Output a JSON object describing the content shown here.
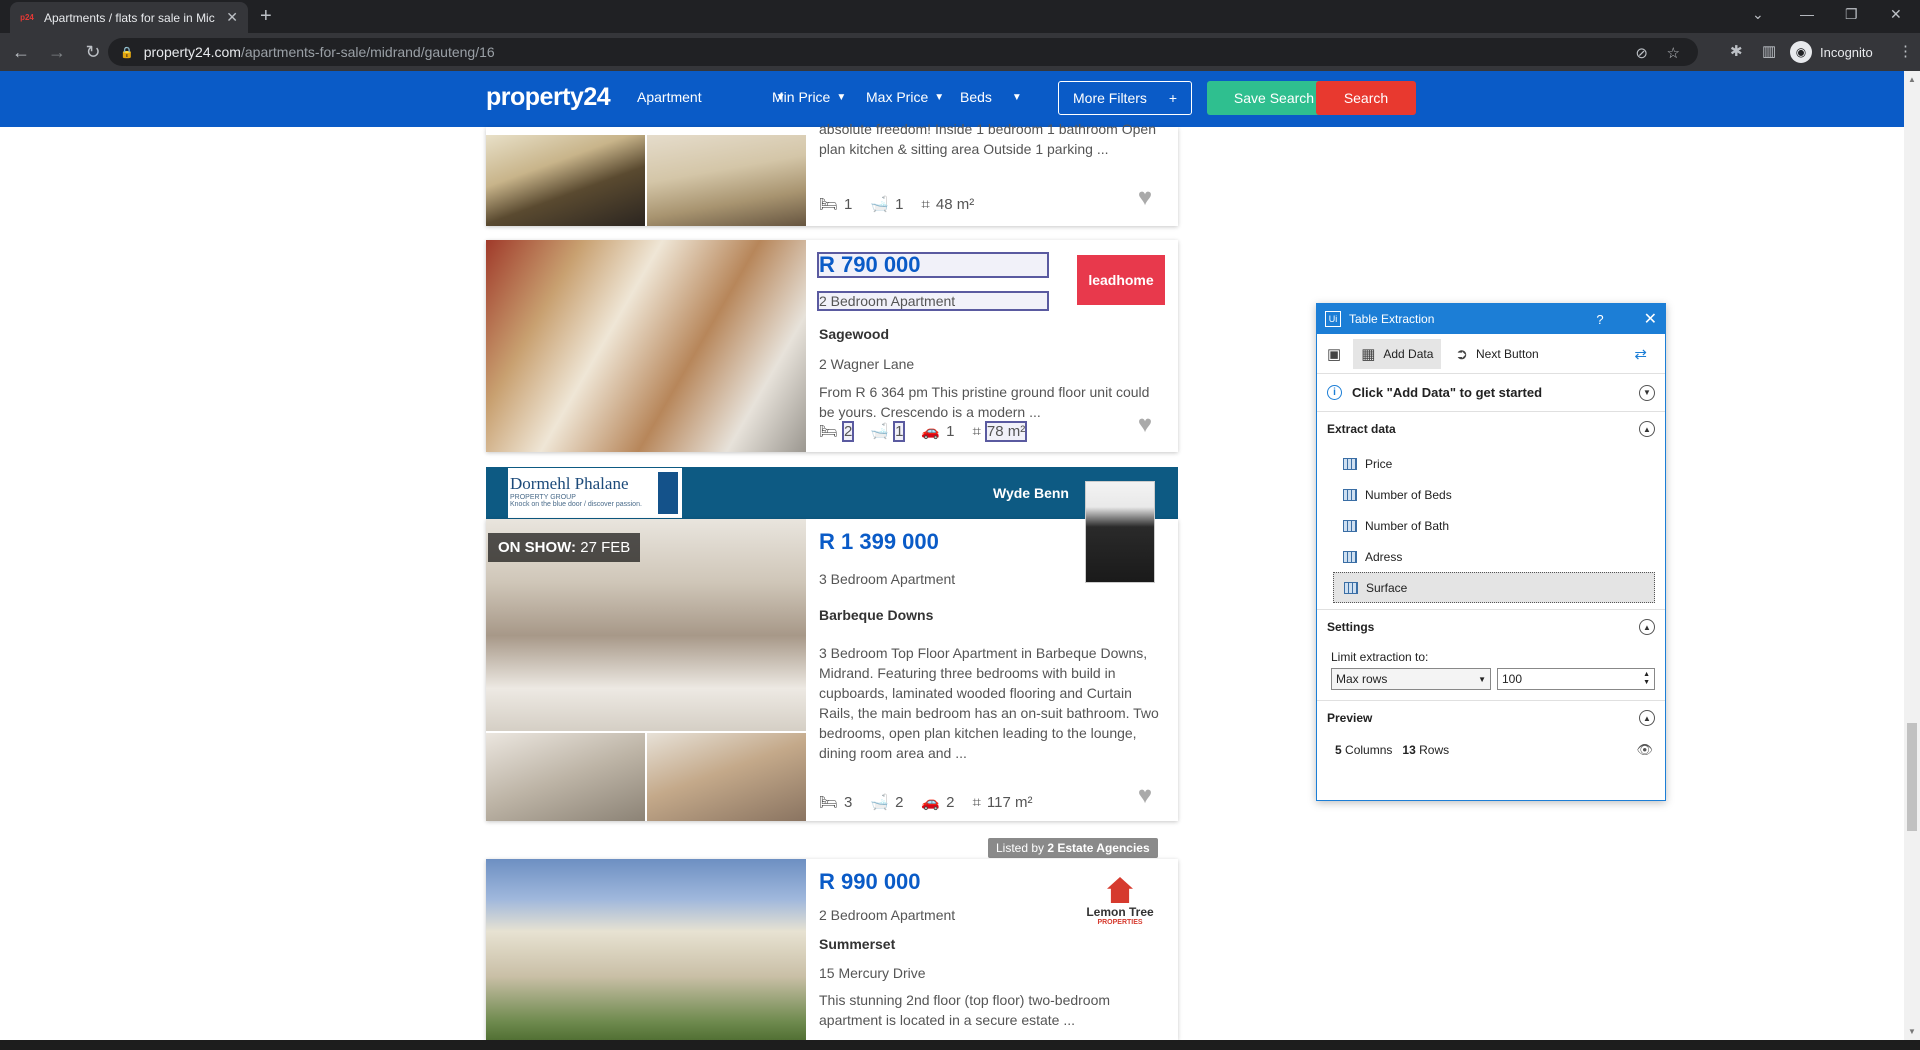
{
  "browser": {
    "tab_title": "Apartments / flats for sale in Mic",
    "tab_favicon": "p24",
    "url_host": "property24.com",
    "url_path": "/apartments-for-sale/midrand/gauteng/16",
    "profile": "Incognito"
  },
  "site": {
    "logo": "property24",
    "type_filter": "Apartment",
    "min_price": "Min Price",
    "max_price": "Max Price",
    "beds": "Beds",
    "more_filters": "More Filters",
    "more_filters_plus": "+",
    "save_search": "Save Search",
    "search": "Search"
  },
  "listings": [
    {
      "description": "absolute freedom! Inside 1 bedroom 1 bathroom Open plan kitchen & sitting area Outside 1 parking ...",
      "beds": "1",
      "baths": "1",
      "size": "48 m²"
    },
    {
      "price": "R 790 000",
      "type": "2 Bedroom Apartment",
      "suburb": "Sagewood",
      "address": "2 Wagner Lane",
      "description": "From R 6 364 pm This pristine ground floor unit could be yours. Crescendo is a modern ...",
      "beds": "2",
      "baths": "1",
      "parking": "1",
      "size": "78 m²",
      "agency_logo": "leadhome"
    },
    {
      "agency": "Dormehl Phalane",
      "agency_sub": "PROPERTY GROUP",
      "agency_tagline": "Knock on the blue door / discover passion.",
      "agent": "Wyde Benn",
      "on_show_label": "ON SHOW:",
      "on_show_date": "27 FEB",
      "price": "R 1 399 000",
      "type": "3 Bedroom Apartment",
      "suburb": "Barbeque Downs",
      "description": "3 Bedroom Top Floor Apartment in Barbeque Downs, Midrand. Featuring three bedrooms with build in cupboards, laminated wooded flooring and Curtain Rails, the main bedroom has an on-suit bathroom. Two bedrooms, open plan kitchen leading to the lounge, dining room area and ...",
      "beds": "3",
      "baths": "2",
      "parking": "2",
      "size": "117 m²"
    },
    {
      "listed_by_prefix": "Listed by",
      "listed_by_agencies": "2 Estate Agencies",
      "price": "R 990 000",
      "type": "2 Bedroom Apartment",
      "suburb": "Summerset",
      "address": "15 Mercury Drive",
      "description": "This stunning 2nd floor (top floor) two-bedroom apartment is located in a secure estate ...",
      "agency_logo": "Lemon Tree",
      "agency_logo_sub": "PROPERTIES"
    }
  ],
  "panel": {
    "title": "Table Extraction",
    "help": "?",
    "add_data": "Add Data",
    "next_button": "Next Button",
    "info": "Click \"Add Data\" to get started",
    "extract_header": "Extract data",
    "fields": [
      "Price",
      "Number of Beds",
      "Number of Bath",
      "Adress",
      "Surface"
    ],
    "settings_header": "Settings",
    "limit_label": "Limit extraction to:",
    "limit_mode": "Max rows",
    "limit_value": "100",
    "preview_header": "Preview",
    "columns": "5",
    "columns_label": "Columns",
    "rows": "13",
    "rows_label": "Rows"
  }
}
